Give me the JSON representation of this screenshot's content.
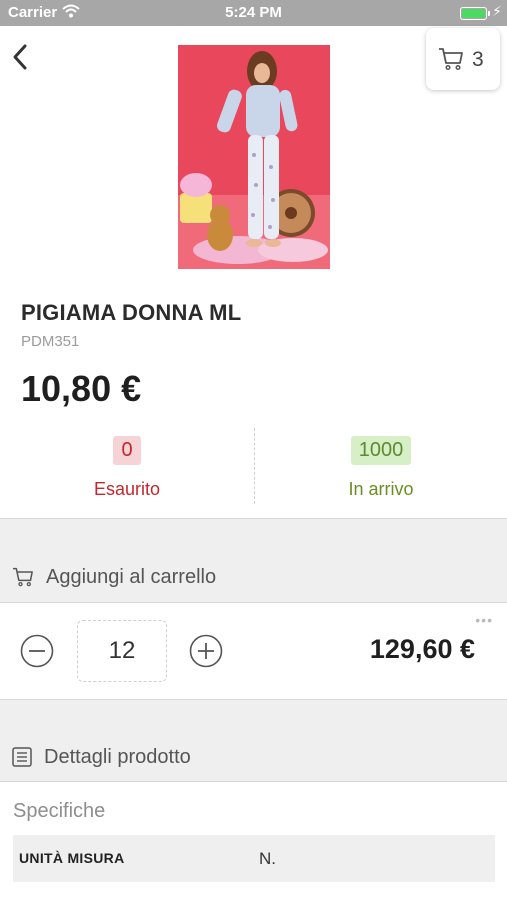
{
  "status_bar": {
    "carrier": "Carrier",
    "time": "5:24 PM",
    "battery_level": 1.0
  },
  "header": {
    "cart_count": "3"
  },
  "product": {
    "name": "PIGIAMA DONNA ML",
    "code": "PDM351",
    "price": "10,80 €"
  },
  "stock": {
    "available": {
      "value": "0",
      "label": "Esaurito",
      "color": "#c4262e"
    },
    "incoming": {
      "value": "1000",
      "label": "In arrivo",
      "color": "#6b8e23"
    }
  },
  "add_to_cart": {
    "title": "Aggiungi al carrello",
    "quantity": "12",
    "total": "129,60 €"
  },
  "details": {
    "title": "Dettagli prodotto",
    "specs_title": "Specifiche",
    "specs": [
      {
        "key": "UNITÀ MISURA",
        "value": "N."
      }
    ]
  },
  "icons": [
    "back-chevron-icon",
    "cart-icon",
    "minus-circle-icon",
    "plus-circle-icon",
    "list-icon",
    "wifi-icon",
    "battery-icon",
    "more-dots-icon"
  ]
}
